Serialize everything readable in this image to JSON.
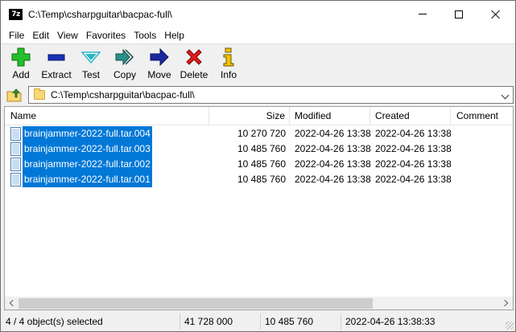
{
  "window": {
    "title": "C:\\Temp\\csharpguitar\\bacpac-full\\",
    "app_icon": "7z"
  },
  "menu": [
    "File",
    "Edit",
    "View",
    "Favorites",
    "Tools",
    "Help"
  ],
  "toolbar": {
    "add": "Add",
    "extract": "Extract",
    "test": "Test",
    "copy": "Copy",
    "move": "Move",
    "delete": "Delete",
    "info": "Info"
  },
  "address": {
    "path": "C:\\Temp\\csharpguitar\\bacpac-full\\"
  },
  "columns": {
    "name": "Name",
    "size": "Size",
    "modified": "Modified",
    "created": "Created",
    "comment": "Comment"
  },
  "files": [
    {
      "name": "brainjammer-2022-full.tar.004",
      "size": "10 270 720",
      "modified": "2022-04-26 13:38",
      "created": "2022-04-26 13:38",
      "selected": true
    },
    {
      "name": "brainjammer-2022-full.tar.003",
      "size": "10 485 760",
      "modified": "2022-04-26 13:38",
      "created": "2022-04-26 13:38",
      "selected": true
    },
    {
      "name": "brainjammer-2022-full.tar.002",
      "size": "10 485 760",
      "modified": "2022-04-26 13:38",
      "created": "2022-04-26 13:38",
      "selected": true
    },
    {
      "name": "brainjammer-2022-full.tar.001",
      "size": "10 485 760",
      "modified": "2022-04-26 13:38",
      "created": "2022-04-26 13:38",
      "selected": true
    }
  ],
  "status": {
    "selection": "4 / 4 object(s) selected",
    "total_size": "41 728 000",
    "focused_size": "10 485 760",
    "focused_date": "2022-04-26 13:38:33"
  },
  "colors": {
    "selection": "#0078d7",
    "add": "#22c12a",
    "extract": "#1a2fb8",
    "test": "#2bb5c7",
    "copy": "#2a8f8a",
    "move": "#1a2a9e",
    "delete": "#e01b1b",
    "info": "#f2c300"
  }
}
